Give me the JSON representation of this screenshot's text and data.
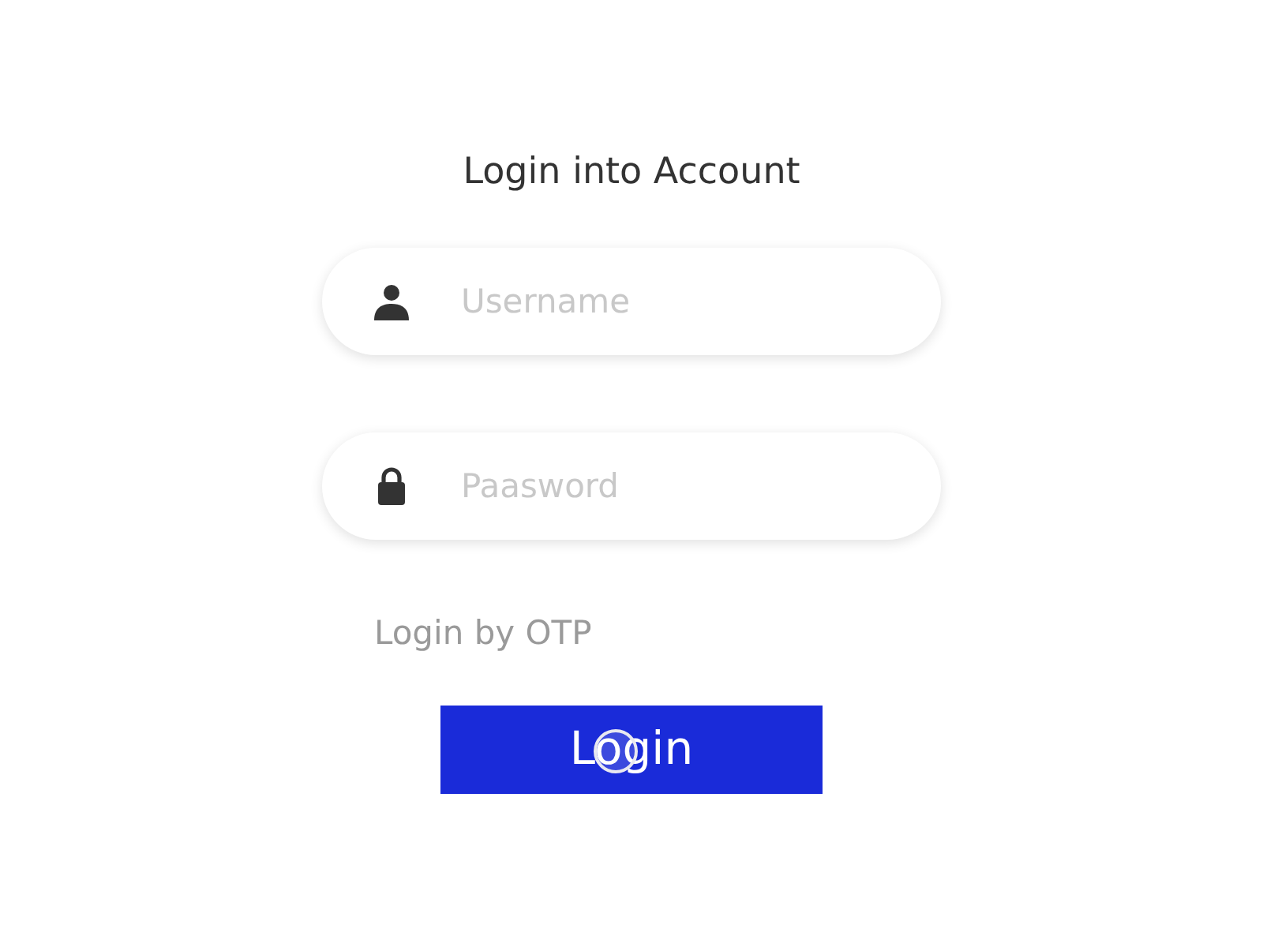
{
  "title": "Login into Account",
  "fields": [
    {
      "kind": "user",
      "placeholder": "Username"
    },
    {
      "kind": "lock",
      "placeholder": "Paasword"
    }
  ],
  "otp_link": "Login by OTP",
  "login_button": "Login"
}
